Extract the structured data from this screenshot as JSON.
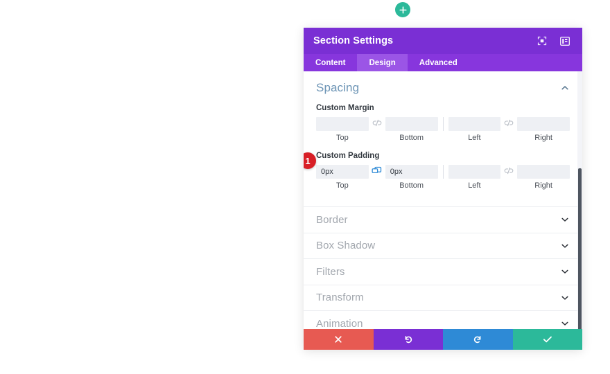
{
  "page": {
    "add_button": {
      "icon": "plus-icon",
      "color": "#2cb99a"
    }
  },
  "modal": {
    "title": "Section Settings",
    "header_icons": [
      {
        "name": "expand-icon"
      },
      {
        "name": "panel-layout-icon"
      }
    ],
    "tabs": [
      {
        "label": "Content",
        "active": false
      },
      {
        "label": "Design",
        "active": true
      },
      {
        "label": "Advanced",
        "active": false
      }
    ],
    "spacing": {
      "title": "Spacing",
      "collapse_icon": "chevron-up-icon",
      "margin": {
        "label": "Custom Margin",
        "link_left_icon": "broken-link-icon",
        "link_right_icon": "broken-link-icon",
        "fields": [
          {
            "caption": "Top",
            "value": "",
            "placeholder": ""
          },
          {
            "caption": "Bottom",
            "value": "",
            "placeholder": ""
          },
          {
            "caption": "Left",
            "value": "",
            "placeholder": ""
          },
          {
            "caption": "Right",
            "value": "",
            "placeholder": ""
          }
        ]
      },
      "padding": {
        "label": "Custom Padding",
        "badge": "1",
        "badge_color": "#d81f26",
        "link_left_icon": "linked-link-icon",
        "link_left_color": "#2e8ad6",
        "link_right_icon": "broken-link-icon",
        "fields": [
          {
            "caption": "Top",
            "value": "0px",
            "placeholder": ""
          },
          {
            "caption": "Bottom",
            "value": "0px",
            "placeholder": ""
          },
          {
            "caption": "Left",
            "value": "",
            "placeholder": ""
          },
          {
            "caption": "Right",
            "value": "",
            "placeholder": ""
          }
        ]
      }
    },
    "accordions": [
      {
        "label": "Border",
        "icon": "chevron-down-icon"
      },
      {
        "label": "Box Shadow",
        "icon": "chevron-down-icon"
      },
      {
        "label": "Filters",
        "icon": "chevron-down-icon"
      },
      {
        "label": "Transform",
        "icon": "chevron-down-icon"
      },
      {
        "label": "Animation",
        "icon": "chevron-down-icon"
      }
    ],
    "footer": [
      {
        "name": "cancel-button",
        "icon": "close-icon",
        "color": "#e75a52"
      },
      {
        "name": "undo-button",
        "icon": "undo-icon",
        "color": "#7a2fd4"
      },
      {
        "name": "redo-button",
        "icon": "redo-icon",
        "color": "#2e8ad6"
      },
      {
        "name": "save-button",
        "icon": "check-icon",
        "color": "#2cb99a"
      }
    ]
  }
}
